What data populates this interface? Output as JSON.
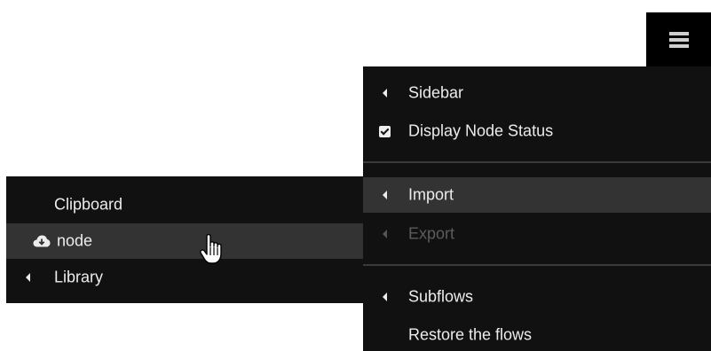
{
  "toolbar": {
    "menu_icon": "hamburger-menu-icon"
  },
  "main_menu": {
    "items": [
      {
        "label": "Sidebar",
        "icon": "caret-left-icon"
      },
      {
        "label": "Display Node Status",
        "icon": "checkbox-checked-icon"
      },
      {
        "label": "Import",
        "icon": "caret-left-icon",
        "state": "highlighted"
      },
      {
        "label": "Export",
        "icon": "caret-left-icon",
        "state": "disabled"
      },
      {
        "label": "Subflows",
        "icon": "caret-left-icon"
      },
      {
        "label": "Restore the flows",
        "icon": ""
      }
    ]
  },
  "import_submenu": {
    "items": [
      {
        "label": "Clipboard",
        "icon": ""
      },
      {
        "label": "node",
        "icon": "cloud-download-icon",
        "state": "highlighted"
      },
      {
        "label": "Library",
        "icon": "caret-left-icon"
      }
    ]
  },
  "colors": {
    "menu_background": "#111111",
    "highlight_background": "#333333",
    "text": "#ececec",
    "disabled_text": "#5c5c5c"
  },
  "cursor": "hand-pointer-icon"
}
